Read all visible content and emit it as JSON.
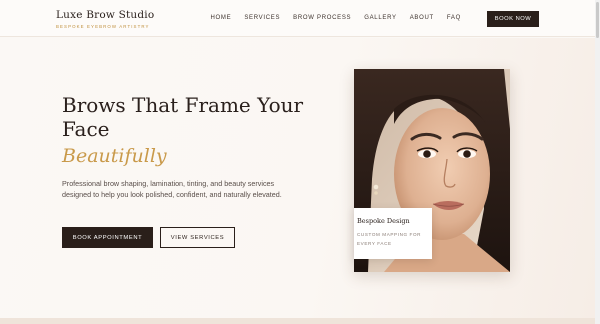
{
  "brand": {
    "name": "Luxe Brow Studio",
    "tagline": "BESPOKE EYEBROW ARTISTRY"
  },
  "nav": {
    "items": [
      {
        "label": "HOME"
      },
      {
        "label": "SERVICES"
      },
      {
        "label": "BROW PROCESS"
      },
      {
        "label": "GALLERY"
      },
      {
        "label": "ABOUT"
      },
      {
        "label": "FAQ"
      }
    ],
    "cta": "BOOK NOW"
  },
  "hero": {
    "title_line1": "Brows That Frame Your",
    "title_line2": "Face",
    "title_accent": "Beautifully",
    "description": "Professional brow shaping, lamination, tinting, and beauty services designed to help you look polished, confident, and naturally elevated.",
    "primary_button": "BOOK APPOINTMENT",
    "secondary_button": "VIEW SERVICES"
  },
  "feature_card": {
    "title": "Bespoke Design",
    "text": "CUSTOM MAPPING FOR EVERY FACE"
  },
  "colors": {
    "accent": "#c99a4a",
    "dark": "#2a1f1a",
    "background": "#fbf8f5"
  }
}
